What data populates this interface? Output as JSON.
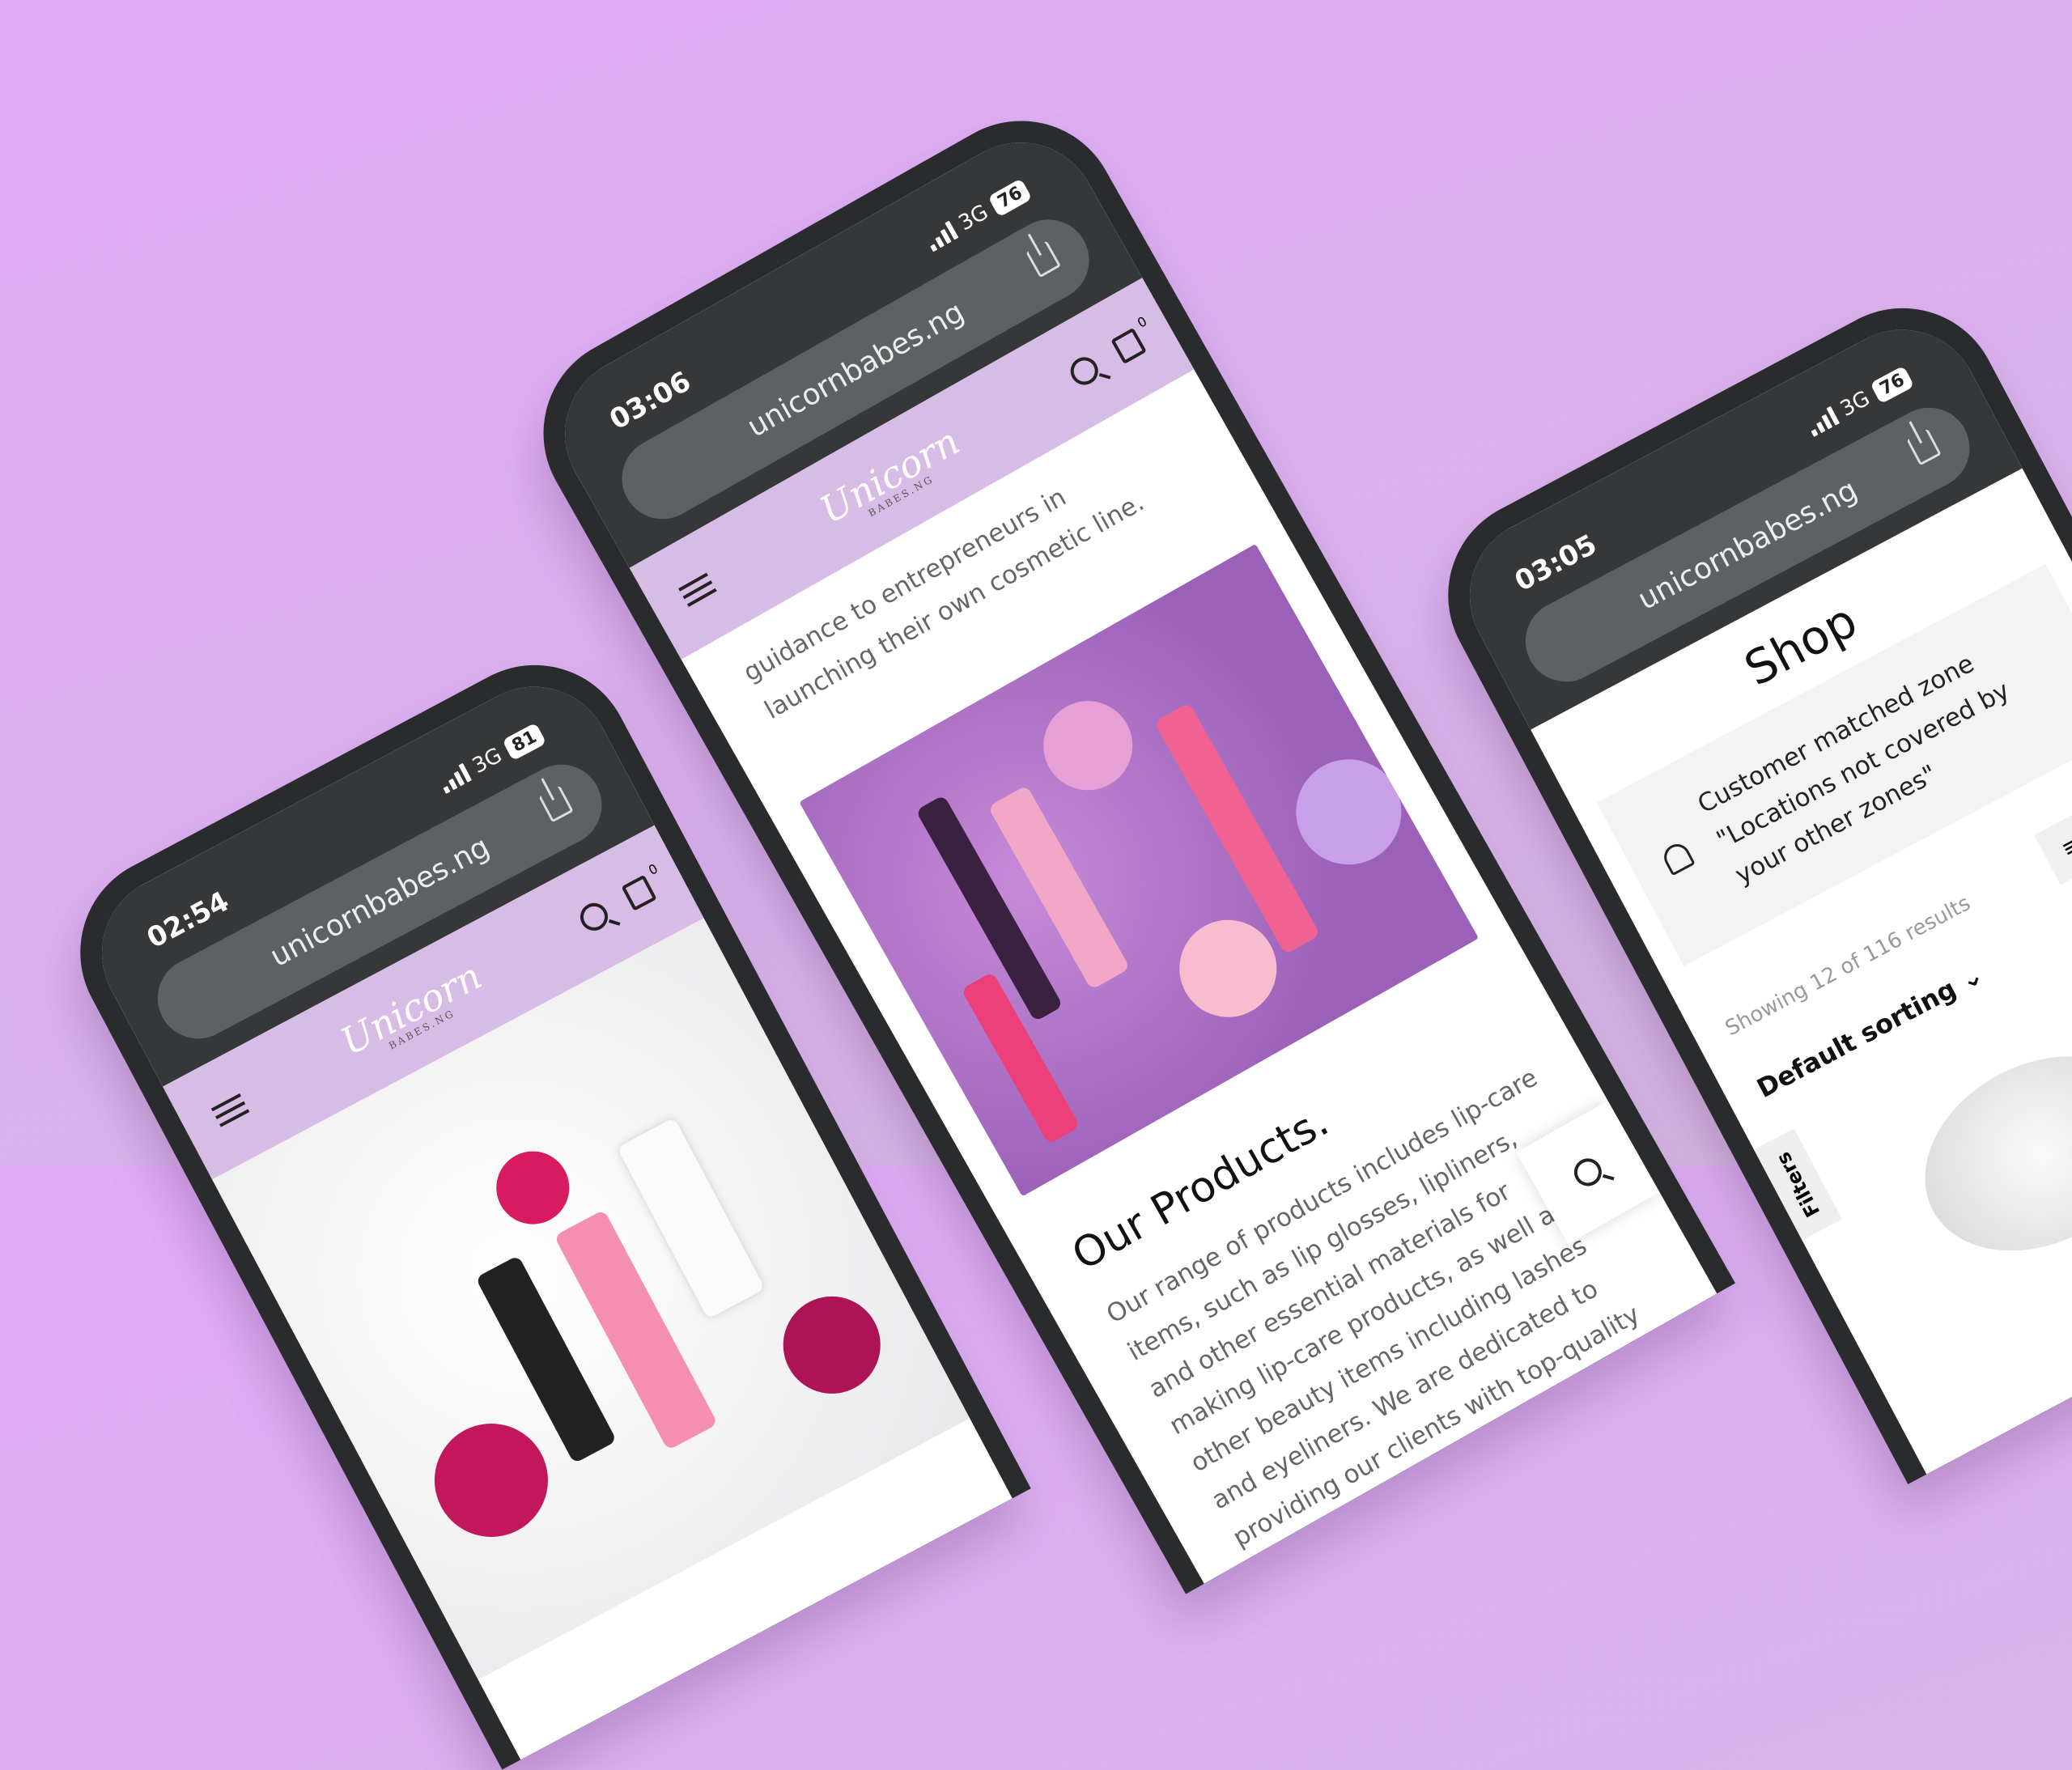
{
  "phones": {
    "left": {
      "time": "02:54",
      "network": "3G",
      "battery": "81",
      "url": "unicornbabes.ng",
      "logo": "Unicorn",
      "logo_sub": "BABES.NG",
      "cart_count": "0"
    },
    "center": {
      "time": "03:06",
      "network": "3G",
      "battery": "76",
      "url": "unicornbabes.ng",
      "logo": "Unicorn",
      "logo_sub": "BABES.NG",
      "cart_count": "0",
      "intro": "guidance to entrepreneurs in launching their own cosmetic line.",
      "heading": "Our Products.",
      "paragraph": "Our range of products includes lip-care items, such as lip glosses, lipliners, and other essential materials for making lip-care products, as well as other beauty items including lashes and eyeliners. We are dedicated to providing our clients with top-quality products that meet their unique needs and continually strive to"
    },
    "right": {
      "time": "03:05",
      "network": "3G",
      "battery": "76",
      "url": "unicornbabes.ng",
      "title": "Shop",
      "notice": "Customer matched zone \"Locations not covered by your other zones\"",
      "results": "Showing 12 of 116 results",
      "list_icon": "≡",
      "grid_icon": "||",
      "sorting": "Default sorting ⌄",
      "filters": "Filters"
    }
  },
  "colors": {
    "header": "#d7bde5",
    "bezel": "#2a2b2d",
    "url_bar": "#5e6163"
  }
}
